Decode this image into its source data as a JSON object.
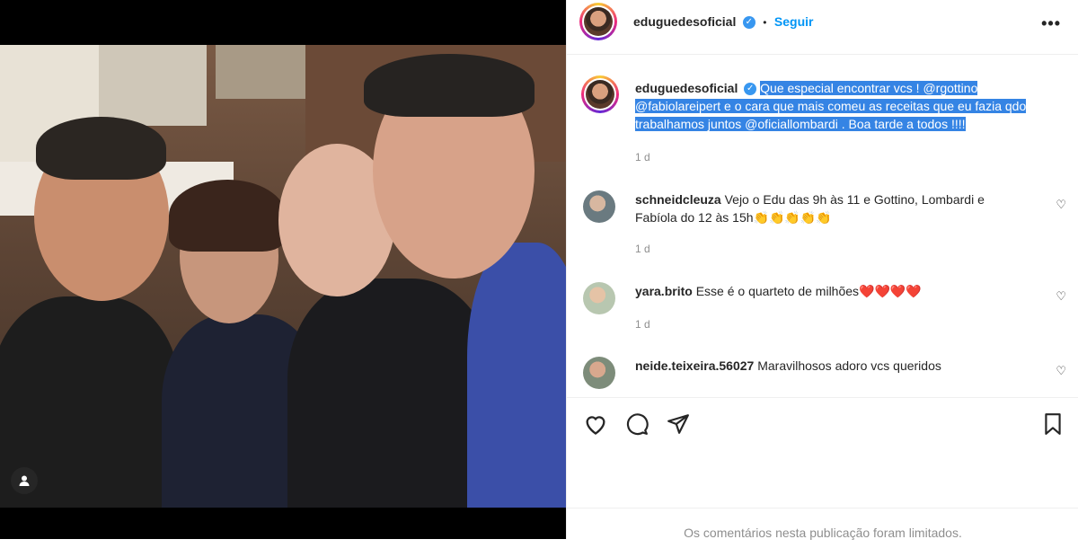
{
  "post": {
    "username": "eduguedesoficial",
    "follow_label": "Seguir",
    "separator": "•",
    "more_label": "•••"
  },
  "caption": {
    "username": "eduguedesoficial",
    "text": "Que especial encontrar vcs ! @rgottino @fabiolareipert e o cara que mais comeu as receitas que eu fazia qdo trabalhamos juntos @oficiallombardi . Boa tarde a todos !!!!",
    "time": "1 d"
  },
  "comments": [
    {
      "username": "schneidcleuza",
      "text": "Vejo o Edu das 9h às 11 e Gottino, Lombardi e Fabíola do 12 às 15h👏👏👏👏👏",
      "time": "1 d"
    },
    {
      "username": "yara.brito",
      "text": "Esse é o quarteto de milhões❤️❤️❤️❤️",
      "time": "1 d"
    },
    {
      "username": "neide.teixeira.56027",
      "text": "Maravilhosos adoro vcs queridos",
      "time": ""
    }
  ],
  "footer": {
    "notice": "Os comentários nesta publicação foram limitados."
  },
  "colors": {
    "accent": "#0095f6",
    "verified": "#3897f0",
    "highlight": "#3584e4"
  },
  "icons": [
    "user-tag-icon",
    "more-icon",
    "verified-icon",
    "heart-icon",
    "comment-icon",
    "share-icon",
    "bookmark-icon"
  ]
}
